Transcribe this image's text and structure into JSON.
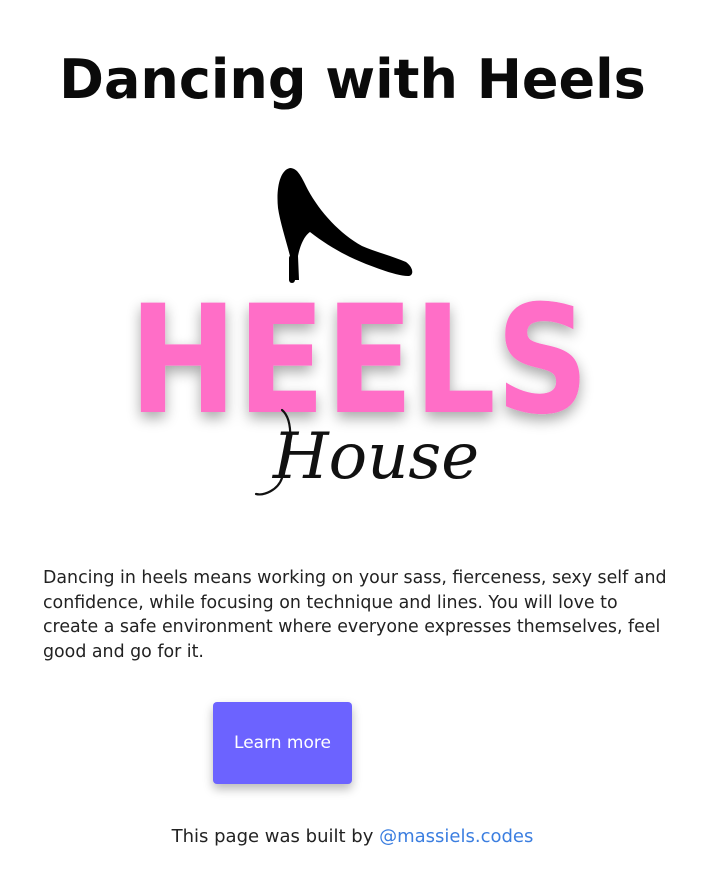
{
  "page": {
    "title": "Dancing with Heels"
  },
  "logo": {
    "icon": "high-heel-shoe-icon",
    "brand_main": "HEELS",
    "brand_sub": "House",
    "brand_color": "#ff6ec7",
    "shoe_color": "#000000"
  },
  "content": {
    "description": "Dancing in heels means working on your sass, fierceness, sexy self and confidence, while focusing on technique and lines. You will love to create a safe environment where everyone expresses themselves, feel good and go for it."
  },
  "cta": {
    "label": "Learn more",
    "color": "#6c63ff"
  },
  "footer": {
    "prefix": "This page was built by ",
    "link_text": "@massiels.codes",
    "link_color": "#3b7ee0"
  }
}
